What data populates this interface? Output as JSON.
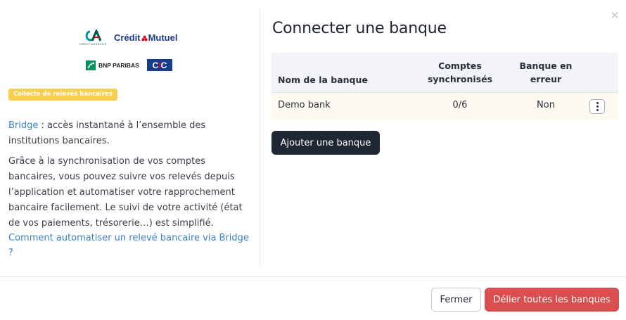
{
  "modal": {
    "close_icon": "close-icon"
  },
  "logos": {
    "credit_agricole_sub": "CRÉDIT AGRICOLE",
    "credit_mutuel_a": "Crédit",
    "credit_mutuel_b": "Mutuel",
    "bnp": "BNP PARIBAS",
    "cic_c1": "C",
    "cic_i": "I",
    "cic_c2": "C"
  },
  "left": {
    "badge": "Collecte de relevés bancaires",
    "desc1_link": "Bridge",
    "desc1_text": " : accès instantané à l’ensemble des institutions bancaires.",
    "desc2": "Grâce à la synchronisation de vos comptes bancaires, vous pouvez suivre vos relevés depuis l’application et automatiser votre rapprochement bancaire facilement. Le suivi de votre activité (état de vos paiements, trésorerie…) est simplifié.",
    "help_link": "Comment automatiser un relevé bancaire via Bridge ?"
  },
  "main": {
    "title": "Connecter une banque",
    "table": {
      "headers": {
        "name": "Nom de la banque",
        "accounts": "Comptes synchronisés",
        "error": "Banque en erreur"
      },
      "rows": [
        {
          "name": "Demo bank",
          "accounts": "0/6",
          "error": "Non"
        }
      ]
    },
    "add_button": "Ajouter une banque"
  },
  "footer": {
    "close_button": "Fermer",
    "unlink_button": "Délier toutes les banques"
  },
  "colors": {
    "primary_dark": "#1f2735",
    "danger": "#d94f4f",
    "badge": "#f7ce4e",
    "link": "#3b82c4",
    "row_highlight": "#fefaf2"
  }
}
